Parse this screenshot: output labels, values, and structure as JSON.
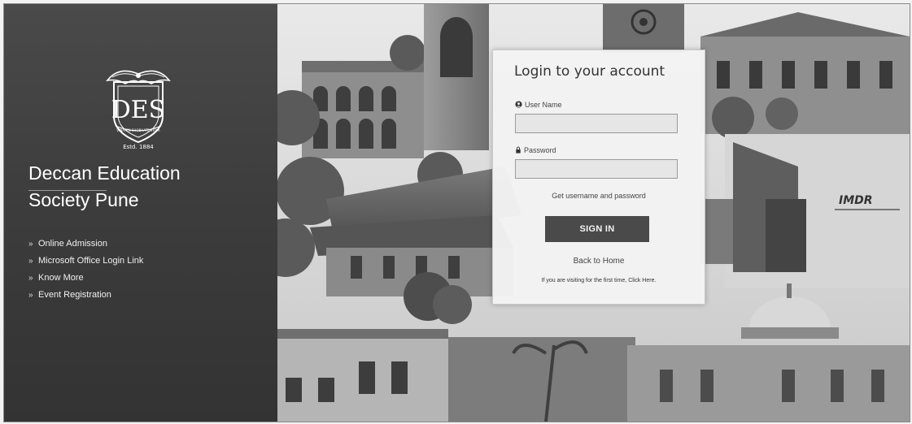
{
  "sidebar": {
    "emblem": {
      "motto": "VINAYEN SHOBHATE VIDYA",
      "monogram": "DES",
      "established": "Estd. 1884"
    },
    "org_name_line1": "Deccan Education",
    "org_name_line2": "Society Pune",
    "links": [
      {
        "label": "Online Admission",
        "icon": "chevron-right-icon"
      },
      {
        "label": "Microsoft Office Login Link",
        "icon": "chevron-right-icon"
      },
      {
        "label": "Know More",
        "icon": "chevron-right-icon"
      },
      {
        "label": "Event Registration",
        "icon": "chevron-right-icon"
      }
    ],
    "link_marker": "»"
  },
  "login": {
    "title": "Login to your account",
    "username_label": "User Name",
    "username_icon": "user-icon",
    "username_value": "",
    "password_label": "Password",
    "password_icon": "lock-icon",
    "password_value": "",
    "help_link": "Get username and password",
    "signin_label": "SIGN IN",
    "back_link": "Back to Home",
    "first_time_text": "If you are visiting for the first time,",
    "click_here": "Click Here."
  },
  "collage": {
    "building_sign": "IMDR"
  },
  "colors": {
    "sidebar_bg": "#3f3f3f",
    "button_bg": "#4a4a4a",
    "card_bg": "#f3f3f3"
  }
}
